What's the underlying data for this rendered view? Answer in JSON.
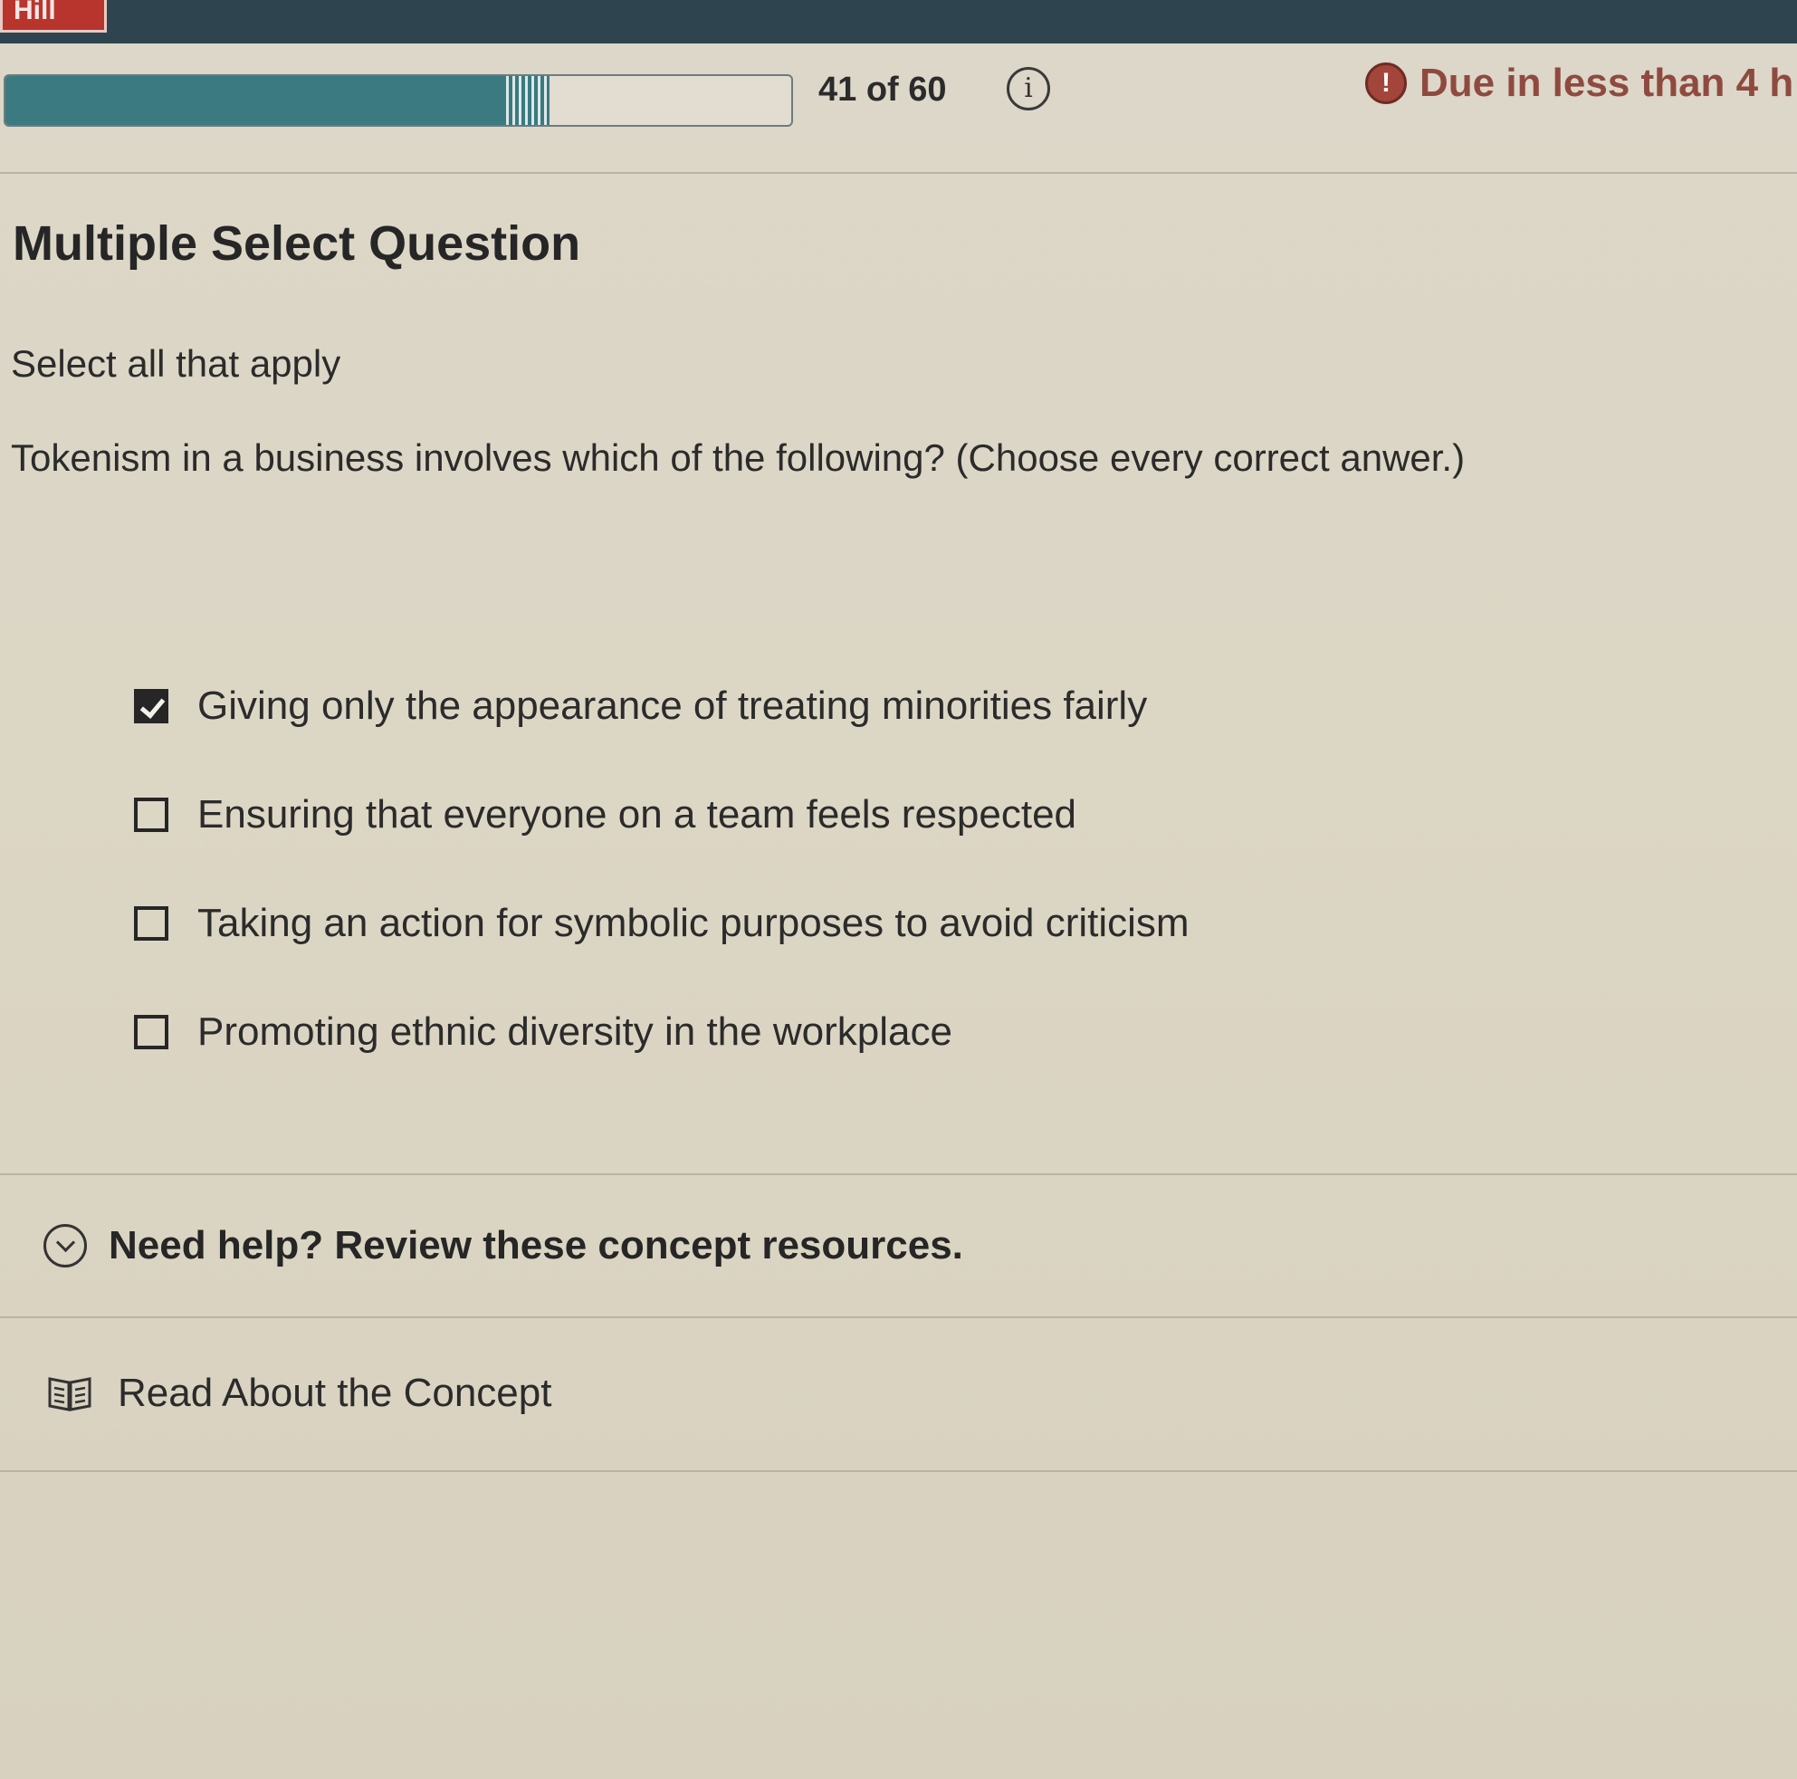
{
  "header": {
    "brand_text": "Hill"
  },
  "progress": {
    "current": 41,
    "total": 60,
    "label": "41 of 60",
    "fill_fraction": 0.683,
    "info_icon": "info-icon",
    "due_text": "Due in less than 4 h",
    "alert_icon": "alert-icon",
    "colors": {
      "fill": "#3a7a80",
      "due": "#8f4a40"
    }
  },
  "question": {
    "type": "Multiple Select Question",
    "instruction": "Select all that apply",
    "prompt": "Tokenism in a business involves which of the following? (Choose every correct anwer.)",
    "options": [
      {
        "label": "Giving only the appearance of treating minorities fairly",
        "checked": true
      },
      {
        "label": "Ensuring that everyone on a team feels respected",
        "checked": false
      },
      {
        "label": "Taking an action for symbolic purposes to avoid criticism",
        "checked": false
      },
      {
        "label": "Promoting ethnic diversity in the workplace",
        "checked": false
      }
    ]
  },
  "help": {
    "toggle_label": "Need help? Review these concept resources.",
    "toggle_icon": "chevron-down-circle-icon",
    "resource_label": "Read About the Concept",
    "resource_icon": "book-icon"
  }
}
